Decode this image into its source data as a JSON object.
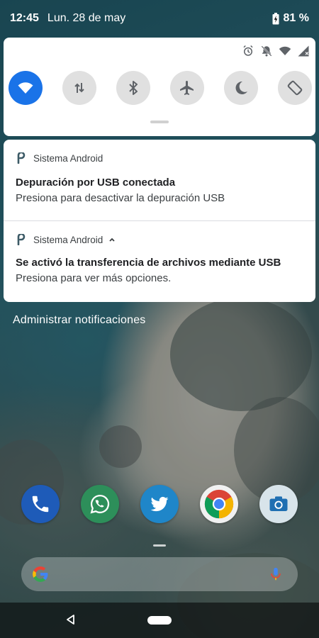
{
  "status_bar": {
    "time": "12:45",
    "date": "Lun. 28 de may",
    "battery": "81 %"
  },
  "quick_settings": {
    "tiles": [
      {
        "name": "wifi",
        "active": true
      },
      {
        "name": "mobile-data",
        "active": false
      },
      {
        "name": "bluetooth",
        "active": false
      },
      {
        "name": "airplane-mode",
        "active": false
      },
      {
        "name": "do-not-disturb",
        "active": false
      },
      {
        "name": "auto-rotate",
        "active": false
      }
    ],
    "accent_color": "#1a73e8"
  },
  "notifications": [
    {
      "app": "Sistema Android",
      "title": "Depuración por USB conectada",
      "text": "Presiona para desactivar la depuración USB"
    },
    {
      "app": "Sistema Android",
      "title": "Se activó la transferencia de archivos mediante USB",
      "text": "Presiona para ver más opciones."
    }
  ],
  "manage_notifications": "Administrar notificaciones",
  "dock": [
    "phone-icon",
    "whatsapp-icon",
    "twitter-icon",
    "chrome-icon",
    "camera-icon"
  ]
}
